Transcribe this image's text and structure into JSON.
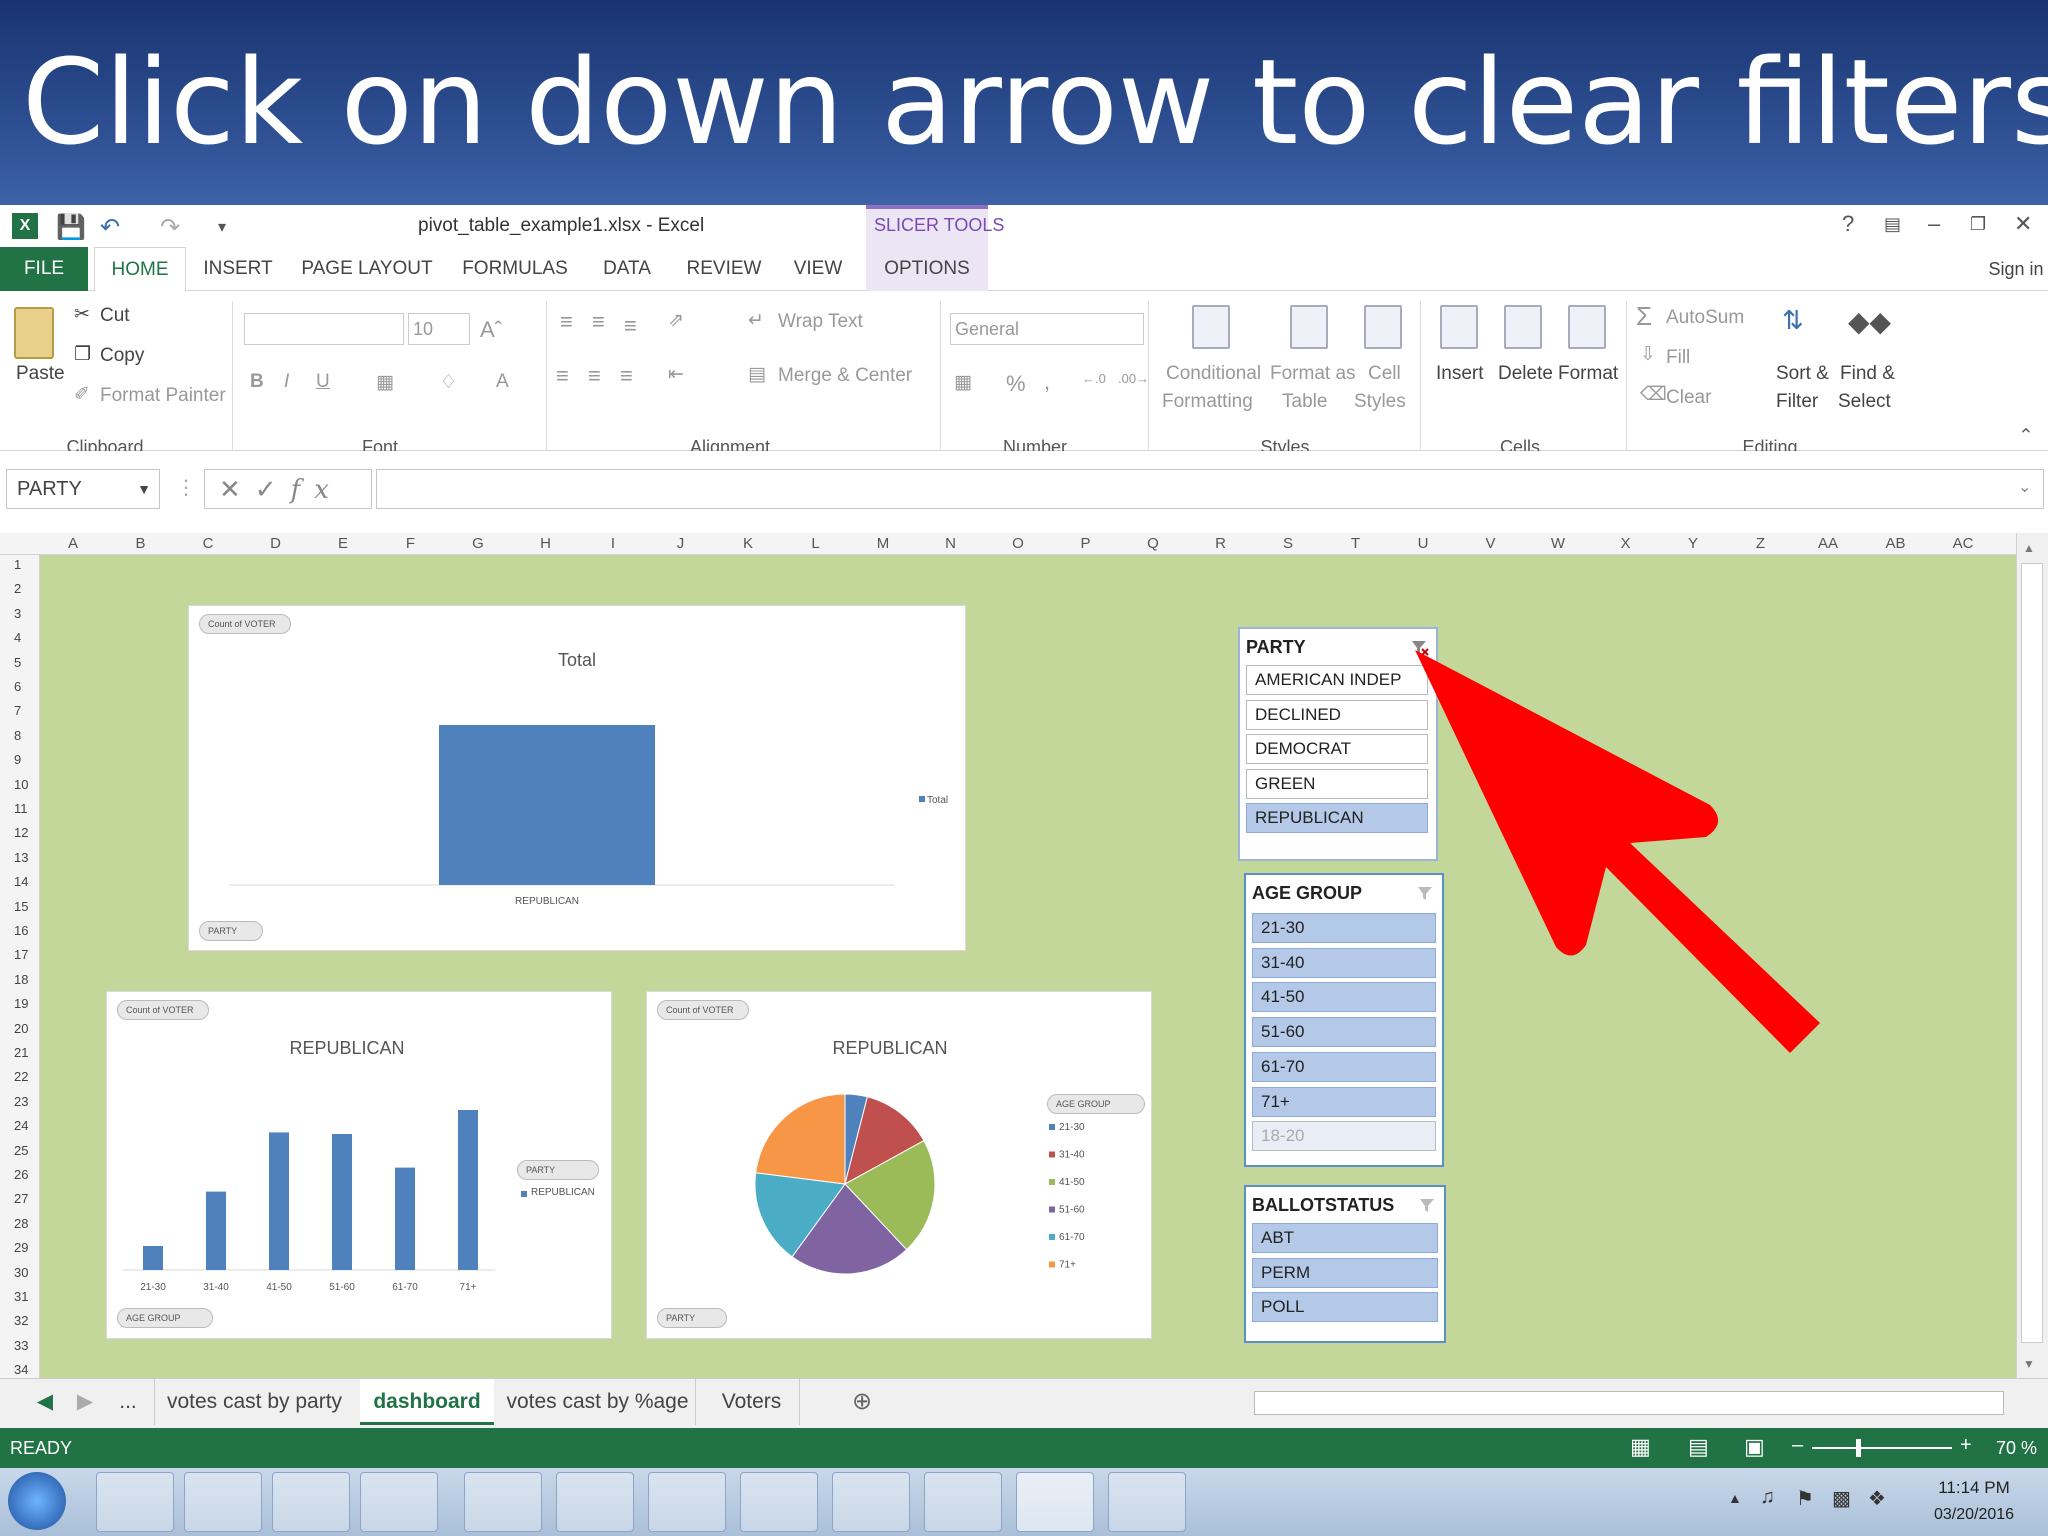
{
  "banner": {
    "text": "Click on down arrow to clear filters"
  },
  "titlebar": {
    "doc_title": "pivot_table_example1.xlsx - Excel",
    "contextual_group": "SLICER TOOLS",
    "help": "?",
    "sign_in": "Sign in"
  },
  "tabs": [
    "FILE",
    "HOME",
    "INSERT",
    "PAGE LAYOUT",
    "FORMULAS",
    "DATA",
    "REVIEW",
    "VIEW",
    "OPTIONS"
  ],
  "ribbon": {
    "clipboard": {
      "paste": "Paste",
      "cut": "Cut",
      "copy": "Copy",
      "format_painter": "Format Painter",
      "group": "Clipboard"
    },
    "font": {
      "size": "10",
      "group": "Font",
      "bold": "B",
      "italic": "I",
      "underline": "U"
    },
    "alignment": {
      "wrap_text": "Wrap Text",
      "merge_center": "Merge & Center",
      "group": "Alignment"
    },
    "number": {
      "format": "General",
      "percent": "%",
      "comma": ",",
      "group": "Number"
    },
    "styles": {
      "conditional": [
        "Conditional",
        "Formatting"
      ],
      "format_table": [
        "Format as",
        "Table"
      ],
      "cell_styles": [
        "Cell",
        "Styles"
      ],
      "group": "Styles"
    },
    "cells": {
      "insert": "Insert",
      "delete": "Delete",
      "format": "Format",
      "group": "Cells"
    },
    "editing": {
      "autosum": "AutoSum",
      "fill": "Fill",
      "clear": "Clear",
      "sort_filter": [
        "Sort &",
        "Filter"
      ],
      "find_select": [
        "Find &",
        "Select"
      ],
      "group": "Editing"
    }
  },
  "formula_bar": {
    "name_box": "PARTY",
    "fx": "fx",
    "value": ""
  },
  "columns": [
    "A",
    "B",
    "C",
    "D",
    "E",
    "F",
    "G",
    "H",
    "I",
    "J",
    "K",
    "L",
    "M",
    "N",
    "O",
    "P",
    "Q",
    "R",
    "S",
    "T",
    "U",
    "V",
    "W",
    "X",
    "Y",
    "Z",
    "AA",
    "AB",
    "AC"
  ],
  "rows": [
    "1",
    "2",
    "3",
    "4",
    "5",
    "6",
    "7",
    "8",
    "9",
    "10",
    "11",
    "12",
    "13",
    "14",
    "15",
    "16",
    "17",
    "18",
    "19",
    "20",
    "21",
    "22",
    "23",
    "24",
    "25",
    "26",
    "27",
    "28",
    "29",
    "30",
    "31",
    "32",
    "33",
    "34"
  ],
  "charts": {
    "total_chart": {
      "field_button": "Count of VOTER",
      "title": "Total",
      "legend": "Total",
      "category": "REPUBLICAN",
      "filter_button": "PARTY"
    },
    "bar_chart": {
      "field_button": "Count of VOTER",
      "title": "REPUBLICAN",
      "legend_filter": "PARTY",
      "legend": "REPUBLICAN",
      "axis_button": "AGE GROUP"
    },
    "pie_chart": {
      "field_button": "Count of VOTER",
      "title": "REPUBLICAN",
      "legend_filter": "AGE GROUP",
      "filter_button": "PARTY"
    }
  },
  "chart_data": [
    {
      "type": "bar",
      "title": "Total",
      "categories": [
        "REPUBLICAN"
      ],
      "series": [
        {
          "name": "Total",
          "values": [
            100
          ]
        }
      ],
      "legend": "right",
      "grid": false
    },
    {
      "type": "bar",
      "title": "REPUBLICAN",
      "categories": [
        "21-30",
        "31-40",
        "41-50",
        "51-60",
        "61-70",
        "71+"
      ],
      "series": [
        {
          "name": "REPUBLICAN",
          "values": [
            15,
            49,
            86,
            85,
            64,
            100
          ]
        }
      ],
      "legend": "right",
      "grid": false
    },
    {
      "type": "pie",
      "title": "REPUBLICAN",
      "categories": [
        "21-30",
        "31-40",
        "41-50",
        "51-60",
        "61-70",
        "71+"
      ],
      "values": [
        4,
        13,
        21,
        22,
        17,
        23
      ],
      "colors": [
        "#4f81bd",
        "#c0504d",
        "#9bbb59",
        "#8064a2",
        "#4bacc6",
        "#f79646"
      ],
      "legend": "right"
    }
  ],
  "slicers": {
    "party": {
      "title": "PARTY",
      "items": [
        {
          "label": "AMERICAN INDEP",
          "state": "off"
        },
        {
          "label": "DECLINED",
          "state": "off"
        },
        {
          "label": "DEMOCRAT",
          "state": "off"
        },
        {
          "label": "GREEN",
          "state": "off"
        },
        {
          "label": "REPUBLICAN",
          "state": "selected"
        }
      ]
    },
    "age_group": {
      "title": "AGE GROUP",
      "items": [
        {
          "label": "21-30",
          "state": "selected"
        },
        {
          "label": "31-40",
          "state": "selected"
        },
        {
          "label": "41-50",
          "state": "selected"
        },
        {
          "label": "51-60",
          "state": "selected"
        },
        {
          "label": "61-70",
          "state": "selected"
        },
        {
          "label": "71+",
          "state": "selected"
        },
        {
          "label": "18-20",
          "state": "nodata"
        }
      ]
    },
    "ballotstatus": {
      "title": "BALLOTSTATUS",
      "items": [
        {
          "label": "ABT",
          "state": "selected"
        },
        {
          "label": "PERM",
          "state": "selected"
        },
        {
          "label": "POLL",
          "state": "selected"
        }
      ]
    }
  },
  "sheet_tabs": {
    "ellipsis": "...",
    "tabs": [
      "votes cast by party",
      "dashboard",
      "votes cast by %age",
      "Voters"
    ],
    "active": "dashboard"
  },
  "status": {
    "text": "READY",
    "zoom": "70 %"
  },
  "taskbar": {
    "time": "11:14 PM",
    "date": "03/20/2016"
  },
  "colors": {
    "excel_green": "#217346",
    "sheet_bg": "#c4d79b",
    "slicer_border": "#5b8fc7",
    "arrow": "#ff0000",
    "bar": "#4f81bd"
  }
}
